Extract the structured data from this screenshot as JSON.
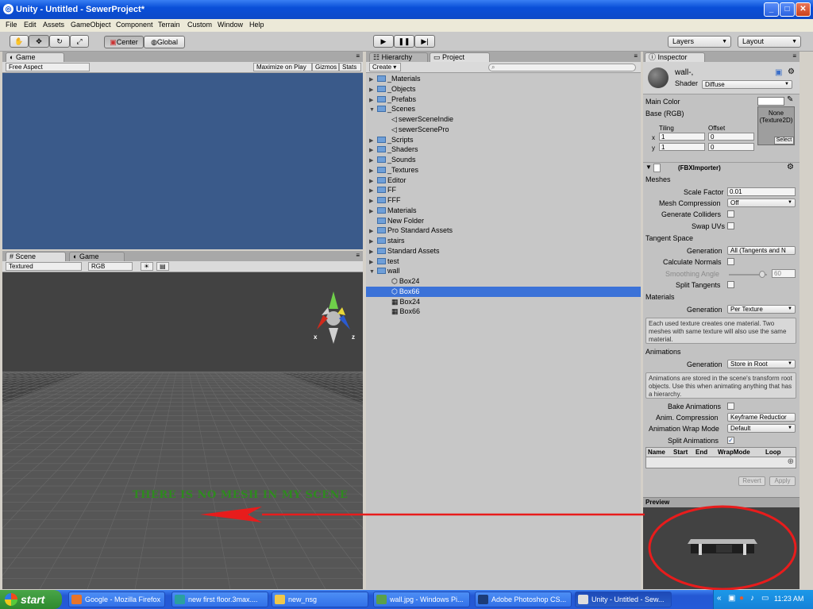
{
  "window": {
    "title": "Unity - Untitled - SewerProject*"
  },
  "menu": [
    "File",
    "Edit",
    "Assets",
    "GameObject",
    "Component",
    "Terrain",
    "Custom",
    "Window",
    "Help"
  ],
  "toolbar": {
    "center_label": "Center",
    "global_label": "Global",
    "layers_label": "Layers",
    "layout_label": "Layout"
  },
  "game_panel": {
    "tab": "Game",
    "aspect": "Free Aspect",
    "maximize": "Maximize on Play",
    "gizmos": "Gizmos",
    "stats": "Stats",
    "bg": "#3a5a8a"
  },
  "scene_panel": {
    "tab_scene": "Scene",
    "tab_game": "Game",
    "render_mode": "Textured",
    "color_mode": "RGB",
    "annotation": "THERE IS NO MESH IN MY SCENE",
    "gizmo_x": "x",
    "gizmo_z": "z"
  },
  "project_panel": {
    "tab_hierarchy": "Hierarchy",
    "tab_project": "Project",
    "create": "Create",
    "items": [
      {
        "label": "_Materials",
        "type": "folder",
        "expand": "▶"
      },
      {
        "label": "_Objects",
        "type": "folder",
        "expand": "▶"
      },
      {
        "label": "_Prefabs",
        "type": "folder",
        "expand": "▶"
      },
      {
        "label": "_Scenes",
        "type": "folder",
        "expand": "▼"
      },
      {
        "label": "sewerSceneIndie",
        "type": "scene",
        "expand": ""
      },
      {
        "label": "sewerScenePro",
        "type": "scene",
        "expand": ""
      },
      {
        "label": "_Scripts",
        "type": "folder",
        "expand": "▶"
      },
      {
        "label": "_Shaders",
        "type": "folder",
        "expand": "▶"
      },
      {
        "label": "_Sounds",
        "type": "folder",
        "expand": "▶"
      },
      {
        "label": "_Textures",
        "type": "folder",
        "expand": "▶"
      },
      {
        "label": "Editor",
        "type": "folder",
        "expand": "▶"
      },
      {
        "label": "FF",
        "type": "folder",
        "expand": "▶"
      },
      {
        "label": "FFF",
        "type": "folder",
        "expand": "▶"
      },
      {
        "label": "Materials",
        "type": "folder",
        "expand": "▶"
      },
      {
        "label": "New Folder",
        "type": "folder",
        "expand": ""
      },
      {
        "label": "Pro Standard Assets",
        "type": "folder",
        "expand": "▶"
      },
      {
        "label": "stairs",
        "type": "folder",
        "expand": "▶"
      },
      {
        "label": "Standard Assets",
        "type": "folder",
        "expand": "▶"
      },
      {
        "label": "test",
        "type": "folder",
        "expand": "▶"
      },
      {
        "label": "wall",
        "type": "folder",
        "expand": "▼"
      },
      {
        "label": "Box24",
        "type": "model",
        "expand": ""
      },
      {
        "label": "Box66",
        "type": "model",
        "expand": "",
        "selected": true
      },
      {
        "label": "Box24",
        "type": "mesh",
        "expand": ""
      },
      {
        "label": "Box66",
        "type": "mesh",
        "expand": ""
      }
    ]
  },
  "inspector": {
    "tab": "Inspector",
    "material_name": "wall-,",
    "shader_label": "Shader",
    "shader_value": "Diffuse",
    "main_color": "Main Color",
    "base_rgb": "Base (RGB)",
    "tiling": "Tiling",
    "offset": "Offset",
    "x_label": "x",
    "y_label": "y",
    "tiling_x": "1",
    "tiling_y": "1",
    "offset_x": "0",
    "offset_y": "0",
    "texture_none": "None\n(Texture2D)",
    "select": "Select",
    "importer": "(FBXImporter)",
    "meshes": "Meshes",
    "scale_factor_label": "Scale Factor",
    "scale_factor": "0.01",
    "mesh_compression_label": "Mesh Compression",
    "mesh_compression": "Off",
    "generate_colliders": "Generate Colliders",
    "swap_uvs": "Swap UVs",
    "tangent_space": "Tangent Space",
    "generation_label": "Generation",
    "tangent_generation": "All (Tangents and N",
    "calculate_normals": "Calculate Normals",
    "smoothing_angle": "Smoothing Angle",
    "smoothing_value": "60",
    "split_tangents": "Split Tangents",
    "materials": "Materials",
    "materials_generation": "Per Texture",
    "materials_help": "Each used texture creates one material. Two meshes with same texture will also use the same material.",
    "animations": "Animations",
    "anim_generation": "Store in Root",
    "anim_help": "Animations are stored in the scene's transform root objects. Use this when animating anything that has a hierarchy.",
    "bake_animations": "Bake Animations",
    "anim_compression_label": "Anim. Compression",
    "anim_compression": "Keyframe Reductior",
    "wrap_mode_label": "Animation Wrap Mode",
    "wrap_mode": "Default",
    "split_animations": "Split Animations",
    "clip_columns": [
      "Name",
      "Start",
      "End",
      "WrapMode",
      "Loop"
    ],
    "revert": "Revert",
    "apply": "Apply",
    "preview": "Preview"
  },
  "taskbar": {
    "start": "start",
    "tasks": [
      {
        "label": "Google - Mozilla Firefox",
        "color": "#e8742a"
      },
      {
        "label": "new first floor.3max....",
        "color": "#2aa0a0"
      },
      {
        "label": "new_nsg",
        "color": "#f0c84a"
      },
      {
        "label": "wall.jpg - Windows Pi...",
        "color": "#5aa04a"
      },
      {
        "label": "Adobe Photoshop CS...",
        "color": "#1c3c78"
      },
      {
        "label": "Unity - Untitled - Sew...",
        "color": "#dddddd"
      }
    ],
    "clock": "11:23 AM"
  },
  "colors": {
    "annotation_text": "#2e8b1e",
    "annotation_arrow": "#e81c1c",
    "selection": "#3b72d8"
  }
}
